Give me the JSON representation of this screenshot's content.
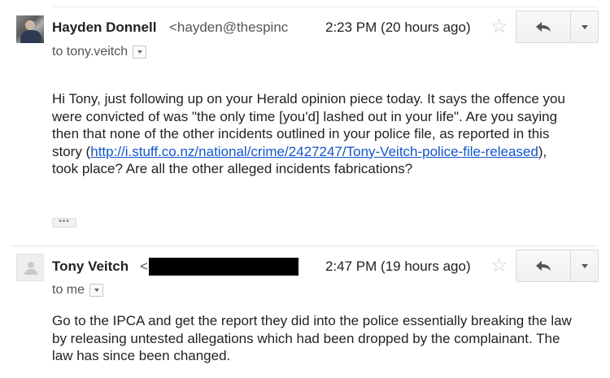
{
  "message1": {
    "sender_name": "Hayden Donnell",
    "sender_email": "<hayden@thespinc",
    "timestamp": "2:23 PM (20 hours ago)",
    "recipient": "to tony.veitch",
    "body_before_link": "Hi Tony, just following up on your Herald opinion piece today. It says the offence you were convicted of was \"the only time [you'd] lashed out in your life\". Are you saying then that none of the other incidents outlined in your police file, as reported in this story (",
    "link": "http://i.stuff.co.nz/national/crime/2427247/Tony-Veitch-police-file-released",
    "body_after_link": "), took place? Are all the other alleged incidents fabrications?",
    "ellipsis": "•••"
  },
  "message2": {
    "sender_name": "Tony Veitch",
    "sender_email": "<",
    "timestamp": "2:47 PM (19 hours ago)",
    "recipient": "to me",
    "body": "Go to the IPCA and get the report they did into the police essentially breaking the law by releasing untested allegations which had been dropped by the complainant. The law has since been changed."
  },
  "icons": {
    "star": "star-outline-icon",
    "reply": "reply-arrow-icon",
    "more": "chevron-down-icon"
  },
  "colors": {
    "link": "#1155cc",
    "star": "#cccccc",
    "redaction": "#000000"
  }
}
